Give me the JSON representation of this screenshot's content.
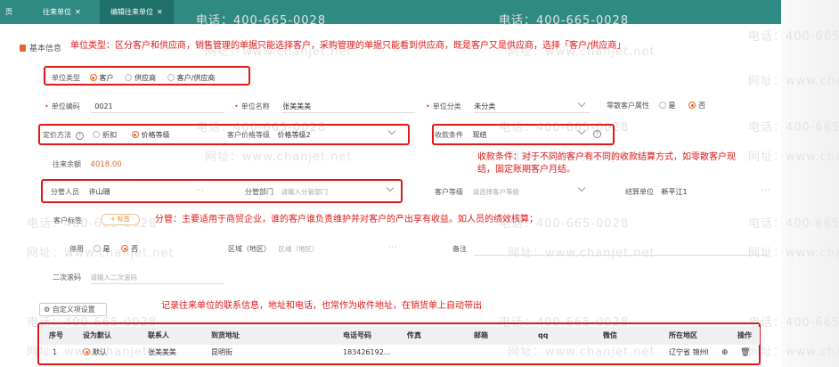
{
  "tabs": [
    {
      "label": "页",
      "closable": false,
      "active": false
    },
    {
      "label": "往来单位",
      "closable": true,
      "active": false
    },
    {
      "label": "编辑往来单位",
      "closable": true,
      "active": true
    }
  ],
  "watermark": {
    "phone": "电话：400-665-0028",
    "site": "网址：www.chanjet.net"
  },
  "section": {
    "title": "基本信息"
  },
  "notes": {
    "unit_type": "单位类型：区分客户和供应商，销售管理的单据只能选择客户，采购管理的单据只能看到供应商，既是客户又是供应商，选择「客户/供应商」",
    "payment_line1": "收款条件：对于不同的客户有不同的收款结算方式，如零散客户现",
    "payment_line2": "结，固定账期客户月结。",
    "manager": "分管：主要适用于商贸企业，谁的客户谁负责维护并对客户的产出享有收益。如人员的绩效核算；",
    "contacts": "记录往来单位的联系信息，地址和电话，也常作为收件地址，在销货单上自动带出"
  },
  "form": {
    "unit_type": {
      "label": "单位类型",
      "options": [
        "客户",
        "供应商",
        "客户/供应商"
      ],
      "selected": "客户"
    },
    "unit_code": {
      "label": "单位编码",
      "value": "0021"
    },
    "unit_name": {
      "label": "单位名称",
      "value": "张美美美"
    },
    "unit_category": {
      "label": "单位分类",
      "value": "未分类"
    },
    "retail_attr": {
      "label": "零散客户属性",
      "options": [
        "是",
        "否"
      ],
      "selected": "否"
    },
    "pricing": {
      "label": "定价方法",
      "options": [
        "折扣",
        "价格等级"
      ],
      "selected": "价格等级"
    },
    "price_level": {
      "label": "客户价格等级",
      "value": "价格等级2"
    },
    "payment_terms": {
      "label": "收款条件",
      "value": "现结"
    },
    "balance": {
      "label": "往来余额",
      "value": "4018.00"
    },
    "manager_person": {
      "label": "分管人员",
      "value": "许山珊"
    },
    "manager_dept": {
      "label": "分管部门",
      "placeholder": "请输入分管部门"
    },
    "customer_level": {
      "label": "客户等级",
      "placeholder": "请选择客户等级"
    },
    "settlement_unit": {
      "label": "结算单位",
      "value": "新平江1"
    },
    "customer_tag": {
      "label": "客户标签",
      "button": "+ 标签"
    },
    "disabled": {
      "label": "停用",
      "options": [
        "是",
        "否"
      ],
      "selected": "否"
    },
    "region": {
      "label": "区域（地区）",
      "placeholder": "区域（地区）"
    },
    "remark": {
      "label": "备注"
    },
    "secondary_code": {
      "label": "二次滚码",
      "placeholder": "请输入二次滚码"
    }
  },
  "custom_settings": {
    "label": "自定义项设置"
  },
  "contacts_table": {
    "headers": [
      "序号",
      "设为默认",
      "联系人",
      "到货地址",
      "电话号码",
      "传真",
      "邮箱",
      "qq",
      "微信",
      "所在地区",
      "操作"
    ],
    "rows": [
      {
        "index": "1",
        "default": "默认",
        "contact": "张美美美",
        "address": "昆明街",
        "phone": "183426192...",
        "fax": "",
        "email": "",
        "qq": "",
        "wechat": "",
        "region": "辽宁省 锦州l"
      }
    ]
  },
  "colors": {
    "brand": "#2f8a84",
    "accent": "#e5672d",
    "annotation": "#e01818"
  }
}
